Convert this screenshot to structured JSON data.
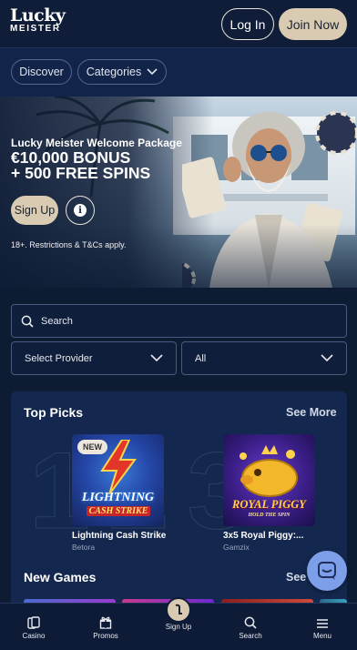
{
  "header": {
    "logo_main": "Lucky",
    "logo_sub": "MEISTER",
    "login_label": "Log In",
    "join_label": "Join Now"
  },
  "filters": {
    "discover_label": "Discover",
    "categories_label": "Categories"
  },
  "hero": {
    "subtitle": "Lucky Meister Welcome Package",
    "title_line1": "€10,000 BONUS",
    "title_line2": "+ 500 FREE SPINS",
    "signup_label": "Sign Up",
    "terms": "18+. Restrictions & T&Cs apply."
  },
  "search": {
    "placeholder": "Search",
    "provider_label": "Select Provider",
    "all_label": "All"
  },
  "top_picks": {
    "title": "Top Picks",
    "see_more": "See More",
    "bg_numbers": "123",
    "games": [
      {
        "name": "Lightning Cash Strike",
        "provider": "Betora",
        "badge": "NEW",
        "art_line1": "LIGHTNING",
        "art_line2": "CASH STRIKE"
      },
      {
        "name": "3x5 Royal Piggy:...",
        "provider": "Gamzix",
        "art_line1": "ROYAL PIGGY",
        "art_line2": "HOLD THE SPIN"
      }
    ]
  },
  "new_games": {
    "title": "New Games",
    "see_more": "See M"
  },
  "bottom_nav": {
    "casino": "Casino",
    "promos": "Promos",
    "signup": "Sign Up",
    "search": "Search",
    "menu": "Menu"
  },
  "colors": {
    "background": "#0d1b33",
    "accent_gold": "#d8cbb2",
    "panel": "#14284f",
    "chat": "#7d9ee8"
  }
}
